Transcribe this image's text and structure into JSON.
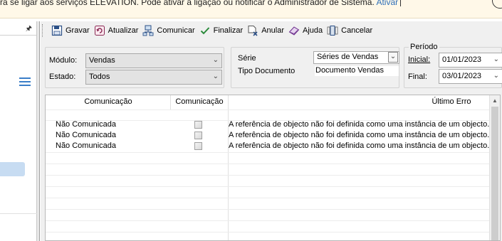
{
  "notice": {
    "text": "ra se ligar aos serviços ELEVATION. Pode ativar a ligação ou notificar o Administrador de Sistema.",
    "link": "Ativar"
  },
  "toolbar": {
    "gravar": "Gravar",
    "atualizar": "Atualizar",
    "comunicar": "Comunicar",
    "finalizar": "Finalizar",
    "anular": "Anular",
    "ajuda": "Ajuda",
    "cancelar": "Cancelar"
  },
  "filters": {
    "modulo_label": "Módulo:",
    "modulo_value": "Vendas",
    "estado_label": "Estado:",
    "estado_value": "Todos",
    "serie_label": "Série",
    "serie_value": "Séries de Vendas",
    "tipo_doc_label": "Tipo Documento",
    "tipo_doc_value": "Documento Vendas"
  },
  "periodo": {
    "title": "Período",
    "inicial_label": "Inicial:",
    "inicial_value": "01/01/2023",
    "final_label": "Final:",
    "final_value": "03/01/2023"
  },
  "grid": {
    "columns": [
      "Comunicação",
      "Comunicação",
      "Último Erro"
    ],
    "rows": [
      {
        "estado": "Não Comunicada",
        "erro": "A referência de objecto não foi definida como uma instância de um objecto."
      },
      {
        "estado": "Não Comunicada",
        "erro": "A referência de objecto não foi definida como uma instância de um objecto."
      },
      {
        "estado": "Não Comunicada",
        "erro": "A referência de objecto não foi definida como uma instância de um objecto."
      }
    ]
  },
  "colors": {
    "accent": "#3a7ec8",
    "notice_bg": "#fff8e8",
    "window_bg": "#f0f0f0"
  }
}
